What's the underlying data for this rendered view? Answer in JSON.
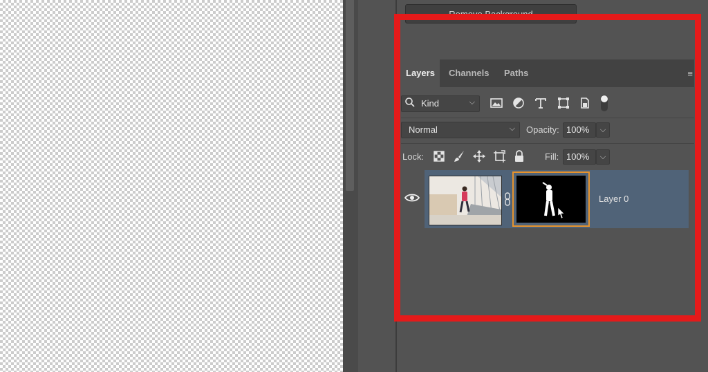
{
  "canvas": {
    "background": "transparency-checkerboard"
  },
  "top_button": {
    "label": "Remove Background"
  },
  "layers_panel": {
    "tabs": [
      {
        "label": "Layers",
        "active": true
      },
      {
        "label": "Channels",
        "active": false
      },
      {
        "label": "Paths",
        "active": false
      }
    ],
    "filter": {
      "kind_label": "Kind",
      "icons": [
        "image-filter-icon",
        "adjustment-filter-icon",
        "type-filter-icon",
        "shape-filter-icon",
        "smart-object-filter-icon",
        "filter-toggle-icon"
      ]
    },
    "blend": {
      "mode": "Normal",
      "opacity_label": "Opacity:",
      "opacity_value": "100%"
    },
    "lock": {
      "label": "Lock:",
      "icons": [
        "lock-transparent-pixels-icon",
        "lock-image-pixels-icon",
        "lock-position-icon",
        "lock-artboard-icon",
        "lock-all-icon"
      ],
      "fill_label": "Fill:",
      "fill_value": "100%"
    },
    "layers": [
      {
        "name": "Layer 0",
        "visible": true,
        "has_mask": true,
        "mask_selected": true
      }
    ]
  },
  "colors": {
    "highlight": "#e51a1a",
    "selected_layer_bg": "#506378",
    "mask_border": "#e7932c",
    "panel_bg": "#535353"
  }
}
